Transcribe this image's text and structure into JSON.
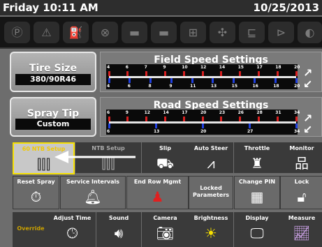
{
  "header": {
    "day_time": "Friday 10:11 AM",
    "date": "10/25/2013"
  },
  "status_icons": [
    "parking-brake-icon",
    "warning-icon",
    "fuel-filter-icon",
    "engine-icon",
    "hydraulic-icon",
    "hydraulic-2-icon",
    "transmission-icon",
    "fan-icon",
    "implement-icon",
    "pump-icon",
    "more-icon"
  ],
  "tire": {
    "title": "Tire Size",
    "value": "380/90R46"
  },
  "spray": {
    "title": "Spray Tip",
    "value": "Custom"
  },
  "field_speed": {
    "title": "Field Speed Settings",
    "top_ticks": [
      "4",
      "6",
      "7",
      "9",
      "10",
      "12",
      "14",
      "15",
      "17",
      "18",
      "20"
    ],
    "bottom_ticks": [
      "4",
      "6",
      "8",
      "9",
      "11",
      "13",
      "15",
      "16",
      "18",
      "20"
    ]
  },
  "road_speed": {
    "title": "Road Speed Settings",
    "top_ticks": [
      "6",
      "9",
      "12",
      "14",
      "17",
      "20",
      "23",
      "26",
      "28",
      "31",
      "34"
    ],
    "bottom_ticks": [
      "6",
      "13",
      "20",
      "27",
      "34"
    ]
  },
  "grid": {
    "row1": [
      "60 NTB Setup",
      "NTB Setup",
      "Slip",
      "Auto Steer",
      "Throttle",
      "Monitor"
    ],
    "row2": [
      "Reset Spray",
      "Service Intervals",
      "End Row Mgmt",
      "Locked Parameters",
      "Change PIN",
      "Lock"
    ],
    "row3": [
      "Override",
      "Adjust Time",
      "Sound",
      "Camera",
      "Brightness",
      "Display",
      "Measure"
    ]
  },
  "colors": {
    "accent_yellow": "#f6e000",
    "red_marker": "#d82020",
    "blue_marker": "#2040e0"
  }
}
